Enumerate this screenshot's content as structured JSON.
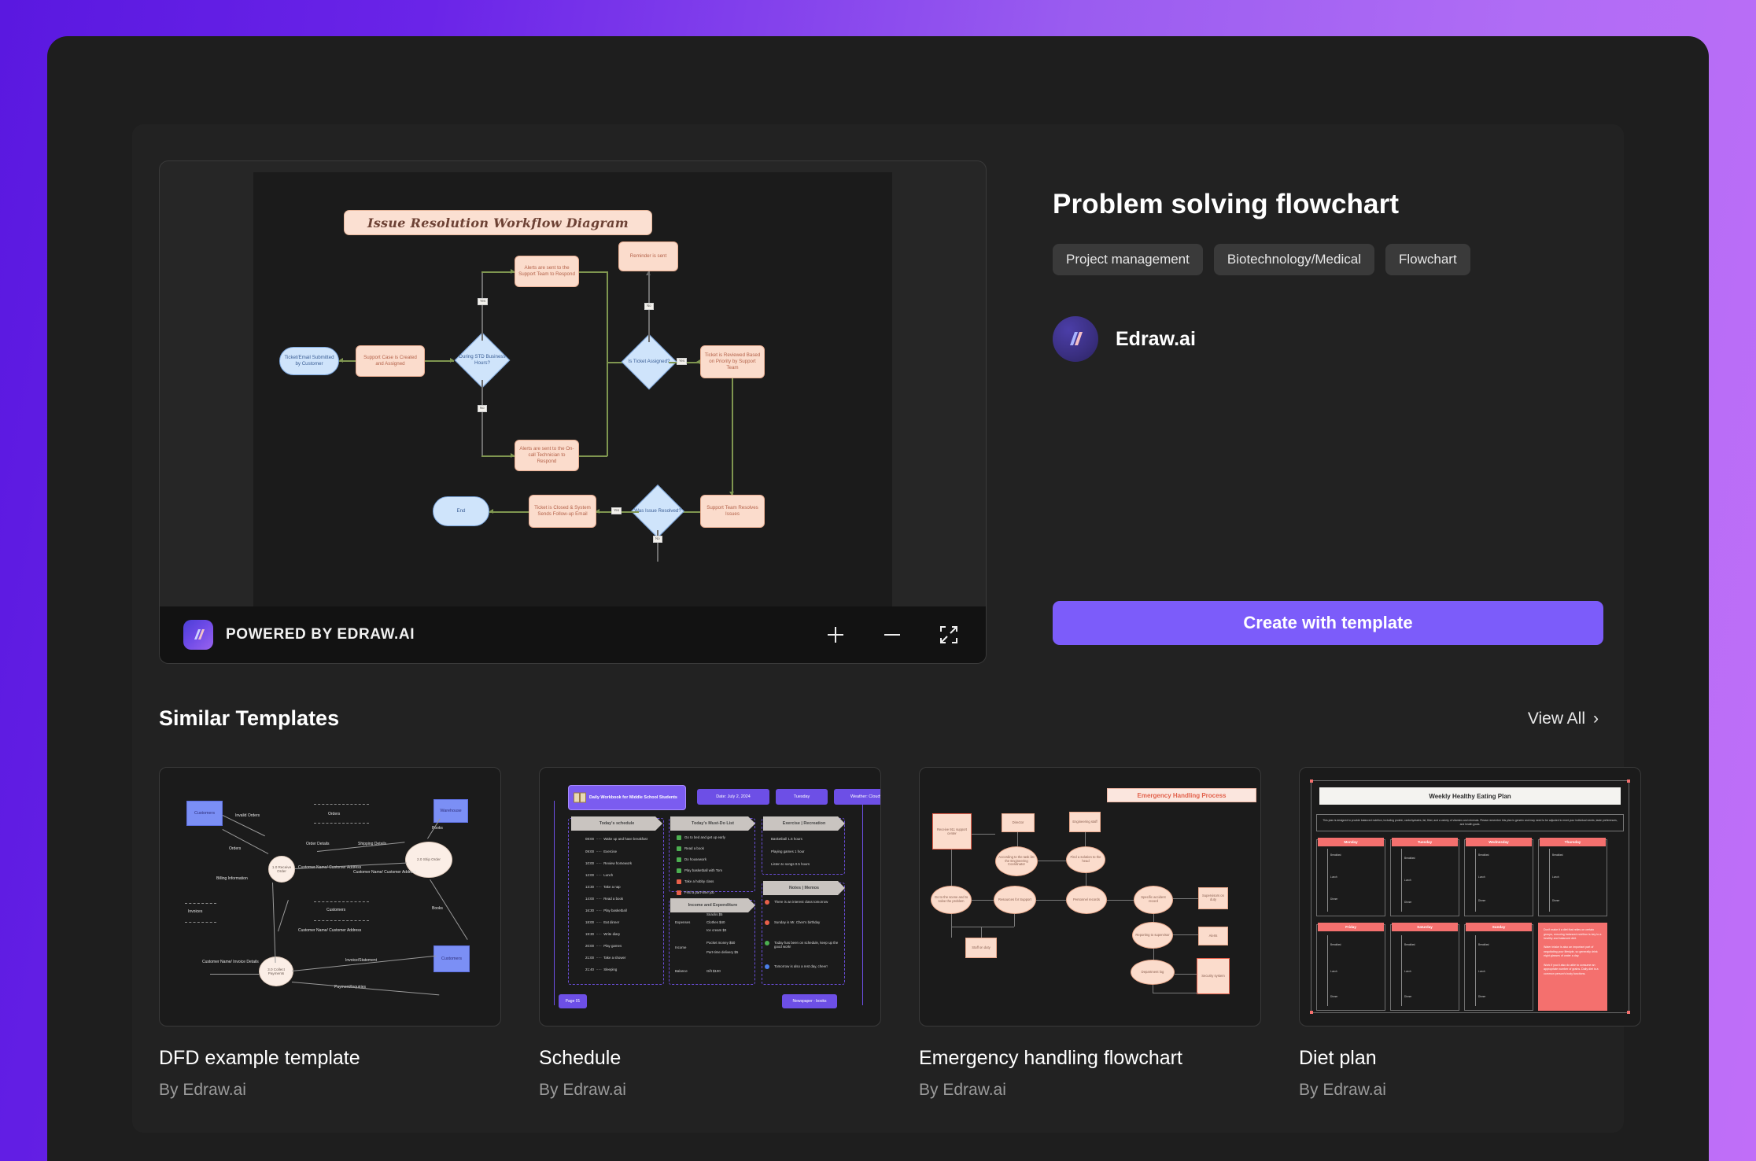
{
  "template": {
    "title": "Problem solving flowchart",
    "tags": [
      "Project management",
      "Biotechnology/Medical",
      "Flowchart"
    ],
    "author": "Edraw.ai",
    "create_button": "Create with template"
  },
  "preview": {
    "powered_by": "POWERED BY EDRAW.AI",
    "zoom_in": "+",
    "zoom_out": "−",
    "fullscreen": "fullscreen-icon"
  },
  "diagram": {
    "title": "Issue Resolution Workflow Diagram",
    "nodes": {
      "start": "Ticket/Email Submitted by Customer",
      "case_created": "Support Case is Created and Assigned",
      "business_hours": "During STD Business Hours?",
      "alerts_support": "Alerts are sent to the Support Team to Respond",
      "alerts_oncall": "Alerts are sent to the On-call Technician to Respond",
      "reminder": "Reminder is sent",
      "is_assigned": "Is Ticket Assigned?",
      "reviewed": "Ticket is Reviewed Based on Priority by Support Team",
      "team_resolves": "Support Team Resolves Issues",
      "was_resolved": "Was Issue Resolved?",
      "closed": "Ticket is Closed & System Sends Follow-up Email",
      "end": "End"
    },
    "edge_labels": {
      "yes1": "Yes",
      "no1": "No",
      "no2": "No",
      "yes2": "Yes",
      "yes3": "Yes",
      "no3": "No"
    }
  },
  "similar": {
    "heading": "Similar Templates",
    "view_all": "View All",
    "chevron": "›",
    "cards": [
      {
        "name": "DFD example template",
        "author": "By Edraw.ai"
      },
      {
        "name": "Schedule",
        "author": "By Edraw.ai"
      },
      {
        "name": "Emergency handling flowchart",
        "author": "By Edraw.ai"
      },
      {
        "name": "Diet plan",
        "author": "By Edraw.ai"
      }
    ]
  },
  "thumb_dfd": {
    "entities": [
      "Customers",
      "Warehouse",
      "Customers"
    ],
    "processes": [
      "1.0 Receive Order",
      "2.0 Ship Order",
      "3.0 Collect Payments"
    ],
    "labels": [
      "Invalid Orders",
      "Orders",
      "Orders",
      "Order Details",
      "Shipping Details",
      "Books",
      "Customer Name/ Customer Address",
      "Customer Name/ Customer Address",
      "Billing Information",
      "Invoices",
      "Customers",
      "Books",
      "Customer Name/ Customer Address",
      "Customer Name/ Invoice Details",
      "Invoice/Statement",
      "Payment/Inquiries"
    ]
  },
  "thumb_schedule": {
    "header": "Daily Workbook for Middle School Students",
    "chips": [
      "Date: July 2, 2024",
      "Tuesday",
      "Weather: Cloudy"
    ],
    "columns": [
      "Today's schedule",
      "Today's Must-Do List",
      "Exercise | Recreation",
      "Notes | Memos",
      "Income and Expenditure"
    ],
    "schedule_rows": [
      [
        "08:00",
        "Wake up and have breakfast"
      ],
      [
        "09:00",
        "Exercise"
      ],
      [
        "10:00",
        "Review homework"
      ],
      [
        "12:00",
        "Lunch"
      ],
      [
        "13:30",
        "Take a nap"
      ],
      [
        "14:00",
        "Read a book"
      ],
      [
        "16:30",
        "Play basketball"
      ],
      [
        "18:00",
        "Eat dinner"
      ],
      [
        "19:30",
        "Write diary"
      ],
      [
        "20:00",
        "Play games"
      ],
      [
        "21:00",
        "Take a shower"
      ],
      [
        "21:40",
        "Sleeping"
      ]
    ],
    "todo": [
      "Go to bed and get up early",
      "Read a book",
      "Do housework",
      "Play basketball with Tom",
      "Take a hobby class",
      "Find a part-time job"
    ],
    "exercise": [
      "Basketball 1.5 hours",
      "Playing games 1 hour",
      "Listen to songs 0.5 hours"
    ],
    "notes": [
      "There is an interest class tomorrow",
      "Sunday is Mr. Chen's birthday",
      "Today has been on schedule, keep up the good work!",
      "Tomorrow is also a rest day, cheer!"
    ],
    "finance": [
      [
        "Expenses",
        "Snacks $5",
        "Clothes $40",
        "Ice cream $3"
      ],
      [
        "Income",
        "Pocket money $50",
        "Part-time delivery $5"
      ],
      [
        "Balance",
        "Gift $100",
        ""
      ]
    ],
    "footer": [
      "Page 01",
      "Newspaper - books"
    ]
  },
  "thumb_emergency": {
    "title": "Emergency Handling Process",
    "nodes": [
      "Receive 911 support center",
      "Director",
      "Engineering staff",
      "According to the task list the Engineering Coordinator",
      "Find a solution to the head",
      "Go to the scene and to solve the problem",
      "Resources for Support",
      "Personnel records",
      "Specific accident record",
      "Supervisors on duty",
      "Reporting to supervisor",
      "Alerts",
      "Department log",
      "Security system",
      "Staff on duty"
    ]
  },
  "thumb_diet": {
    "title": "Weekly Healthy Eating Plan",
    "description": "This plan is designed to provide balanced nutrition, including protein, carbohydrates, fat, fiber, and a variety of vitamins and minerals. Please remember this plan is generic and may need to be adjusted to meet your individual needs, taste preferences, and health goals.",
    "days": [
      "Monday",
      "Tuesday",
      "Wednesday",
      "Thursday",
      "Friday",
      "Saturday",
      "Sunday"
    ],
    "meals": [
      "Breakfast",
      "Lunch",
      "Dinner"
    ],
    "note": "Don't make it a diet that relies on certain groups, ensuring balanced nutrition is key to a healthy and balanced diet.\n\nWater intake is also an important part of negotiating your lifestyle, so generally drink eight glasses of water a day.\n\nWork if you'd also do able to consume an appropriate number of grains. Daily diet is a common person's body functions."
  }
}
